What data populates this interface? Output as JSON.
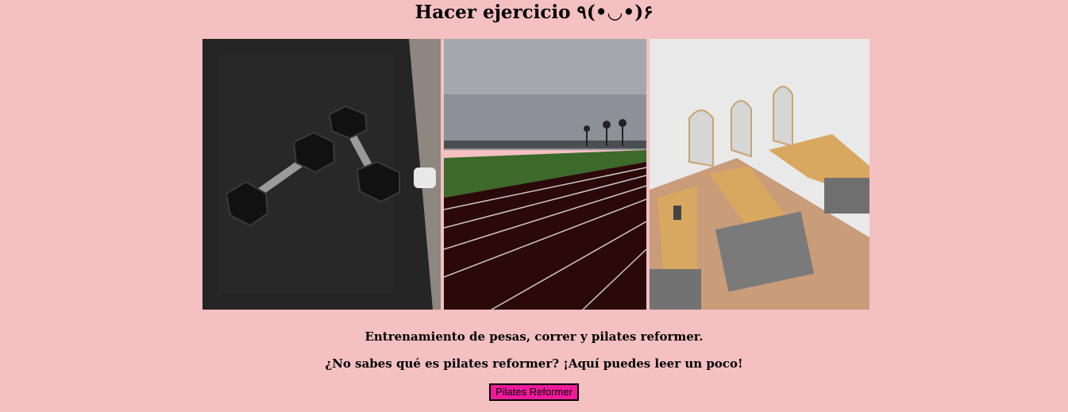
{
  "page": {
    "title": "Hacer ejercicio ٩(•◡•)۶"
  },
  "gallery": {
    "images": [
      {
        "alt": "dumbbells"
      },
      {
        "alt": "running track"
      },
      {
        "alt": "pilates reformer studio"
      }
    ]
  },
  "content": {
    "description": "Entrenamiento de pesas, correr y pilates reformer.",
    "question": "¿No sabes qué es pilates reformer? ¡Aquí puedes leer un poco!"
  },
  "actions": {
    "button_label": "Pilates Reformer"
  },
  "colors": {
    "background": "#f4c0c2",
    "button": "#ef1a9b"
  }
}
